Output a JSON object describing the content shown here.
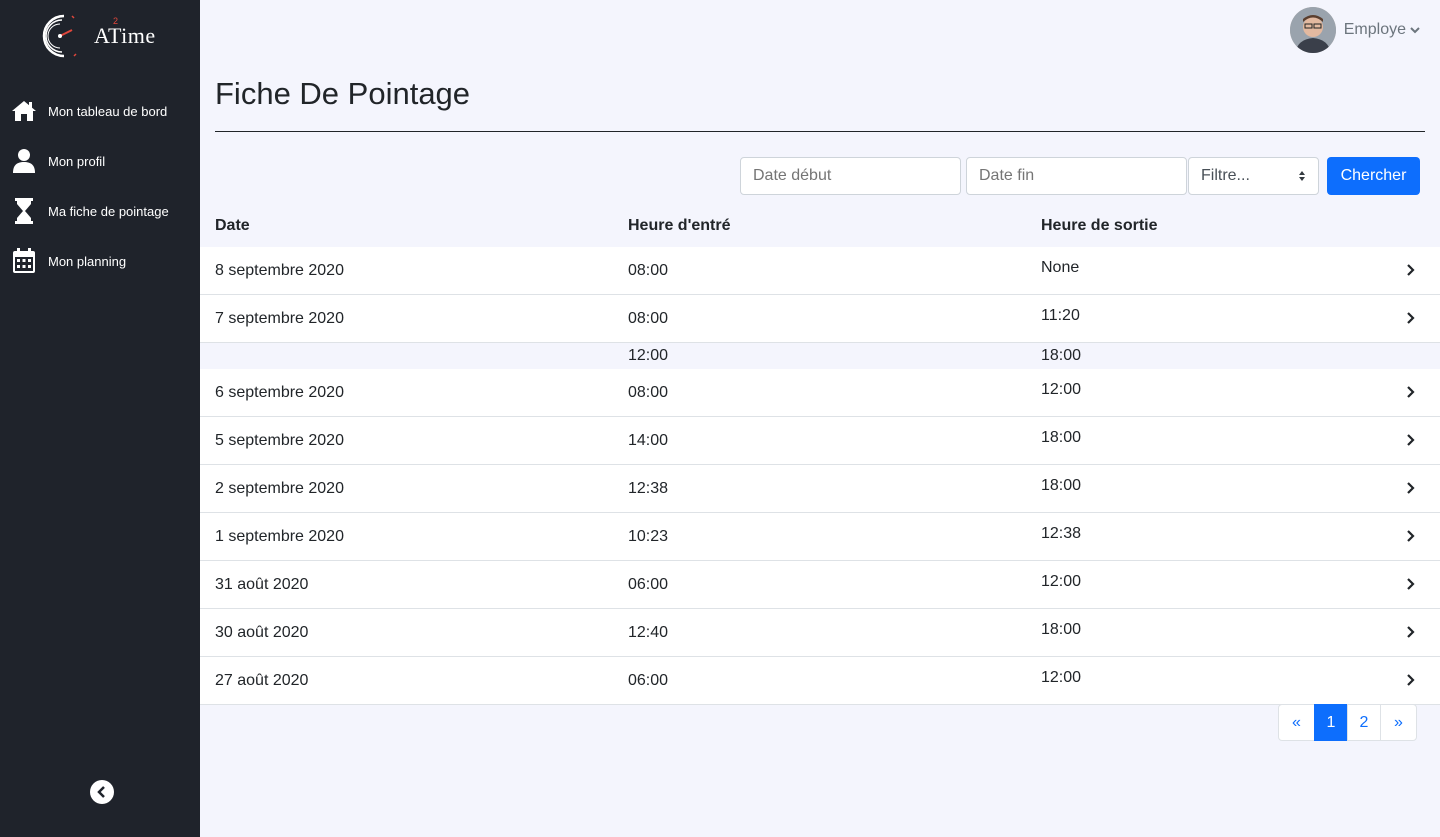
{
  "app": {
    "logo_text": "ATime",
    "logo_sup": "2"
  },
  "sidebar": {
    "items": [
      {
        "label": "Mon tableau de bord",
        "icon": "home-icon"
      },
      {
        "label": "Mon profil",
        "icon": "user-icon"
      },
      {
        "label": "Ma fiche de pointage",
        "icon": "hourglass-icon"
      },
      {
        "label": "Mon planning",
        "icon": "calendar-icon"
      }
    ],
    "collapse_icon": "chevron-left-circle-icon"
  },
  "topbar": {
    "user_name": "Employe"
  },
  "page": {
    "title": "Fiche De Pointage"
  },
  "filters": {
    "date_start_placeholder": "Date début",
    "date_end_placeholder": "Date fin",
    "select_value": "Filtre...",
    "search_label": "Chercher"
  },
  "table": {
    "headers": [
      "Date",
      "Heure d'entré",
      "Heure de sortie"
    ],
    "rows": [
      {
        "date": "8 septembre 2020",
        "in": "08:00",
        "out": "None"
      },
      {
        "date": "7 septembre 2020",
        "in": "08:00",
        "out": "11:20",
        "sub": {
          "in": "12:00",
          "out": "18:00"
        }
      },
      {
        "date": "6 septembre 2020",
        "in": "08:00",
        "out": "12:00"
      },
      {
        "date": "5 septembre 2020",
        "in": "14:00",
        "out": "18:00"
      },
      {
        "date": "2 septembre 2020",
        "in": "12:38",
        "out": "18:00"
      },
      {
        "date": "1 septembre 2020",
        "in": "10:23",
        "out": "12:38"
      },
      {
        "date": "31 août 2020",
        "in": "06:00",
        "out": "12:00"
      },
      {
        "date": "30 août 2020",
        "in": "12:40",
        "out": "18:00"
      },
      {
        "date": "27 août 2020",
        "in": "06:00",
        "out": "12:00"
      }
    ]
  },
  "pagination": {
    "prev": "«",
    "pages": [
      "1",
      "2"
    ],
    "active": "1",
    "next": "»"
  },
  "colors": {
    "sidebar_bg": "#1f232b",
    "accent": "#0d6efd",
    "page_bg": "#f4f5fd"
  }
}
